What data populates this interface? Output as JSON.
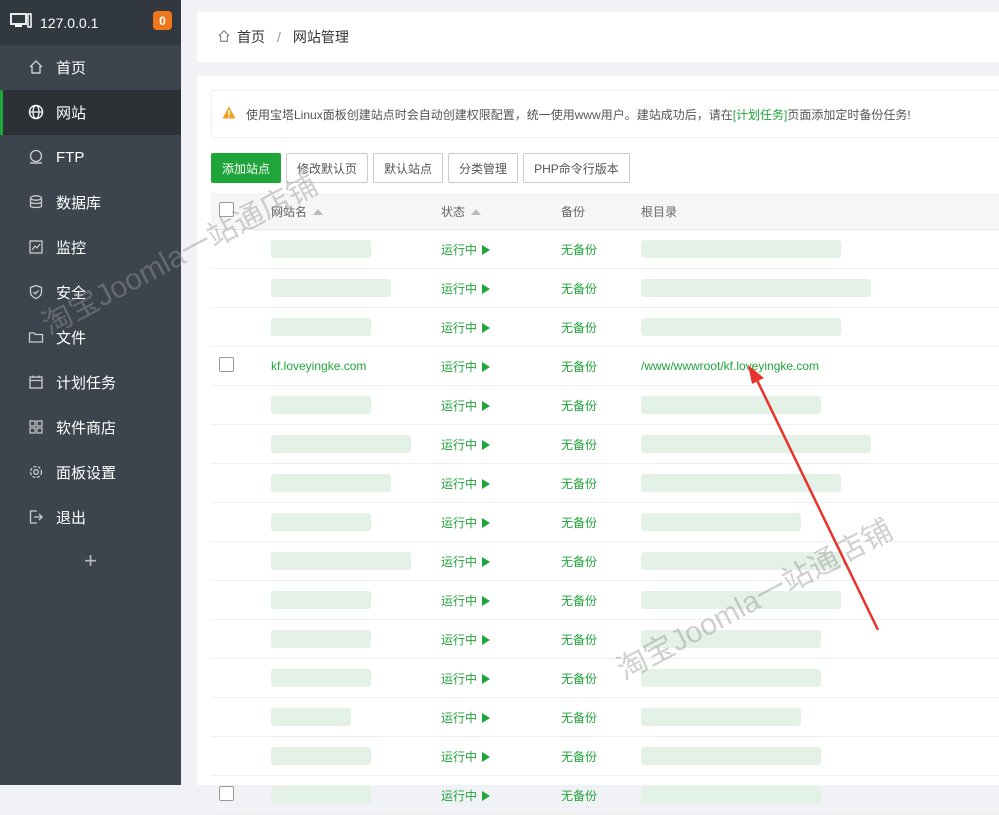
{
  "sidebar": {
    "host": "127.0.0.1",
    "badge": "0",
    "items": [
      {
        "label": "首页",
        "icon": "home-icon"
      },
      {
        "label": "网站",
        "icon": "globe-icon"
      },
      {
        "label": "FTP",
        "icon": "ftp-icon"
      },
      {
        "label": "数据库",
        "icon": "database-icon"
      },
      {
        "label": "监控",
        "icon": "monitor-icon"
      },
      {
        "label": "安全",
        "icon": "shield-icon"
      },
      {
        "label": "文件",
        "icon": "folder-icon"
      },
      {
        "label": "计划任务",
        "icon": "calendar-icon"
      },
      {
        "label": "软件商店",
        "icon": "apps-icon"
      },
      {
        "label": "面板设置",
        "icon": "gear-icon"
      },
      {
        "label": "退出",
        "icon": "logout-icon"
      }
    ],
    "plus": "+"
  },
  "breadcrumb": {
    "home": "首页",
    "sep": "/",
    "current": "网站管理"
  },
  "notice": {
    "text_before": "使用宝塔Linux面板创建站点时会自动创建权限配置，统一使用www用户。建站成功后，请在",
    "link": "[计划任务]",
    "text_after": "页面添加定时备份任务!"
  },
  "toolbar": {
    "add_site": "添加站点",
    "edit_default_page": "修改默认页",
    "default_site": "默认站点",
    "category_manage": "分类管理",
    "php_cli_version": "PHP命令行版本"
  },
  "table": {
    "headers": {
      "name": "网站名",
      "status": "状态",
      "backup": "备份",
      "root": "根目录"
    },
    "status_text": "运行中",
    "backup_text": "无备份",
    "visible_row": {
      "name": "kf.loveyingke.com",
      "root": "/www/wwwroot/kf.loveyingke.com"
    }
  },
  "watermark": "淘宝Joomla一站通店铺",
  "colors": {
    "accent": "#20a53a",
    "sidebar": "#3c444d",
    "badge": "#f0761b",
    "arrow": "#e8322c"
  }
}
